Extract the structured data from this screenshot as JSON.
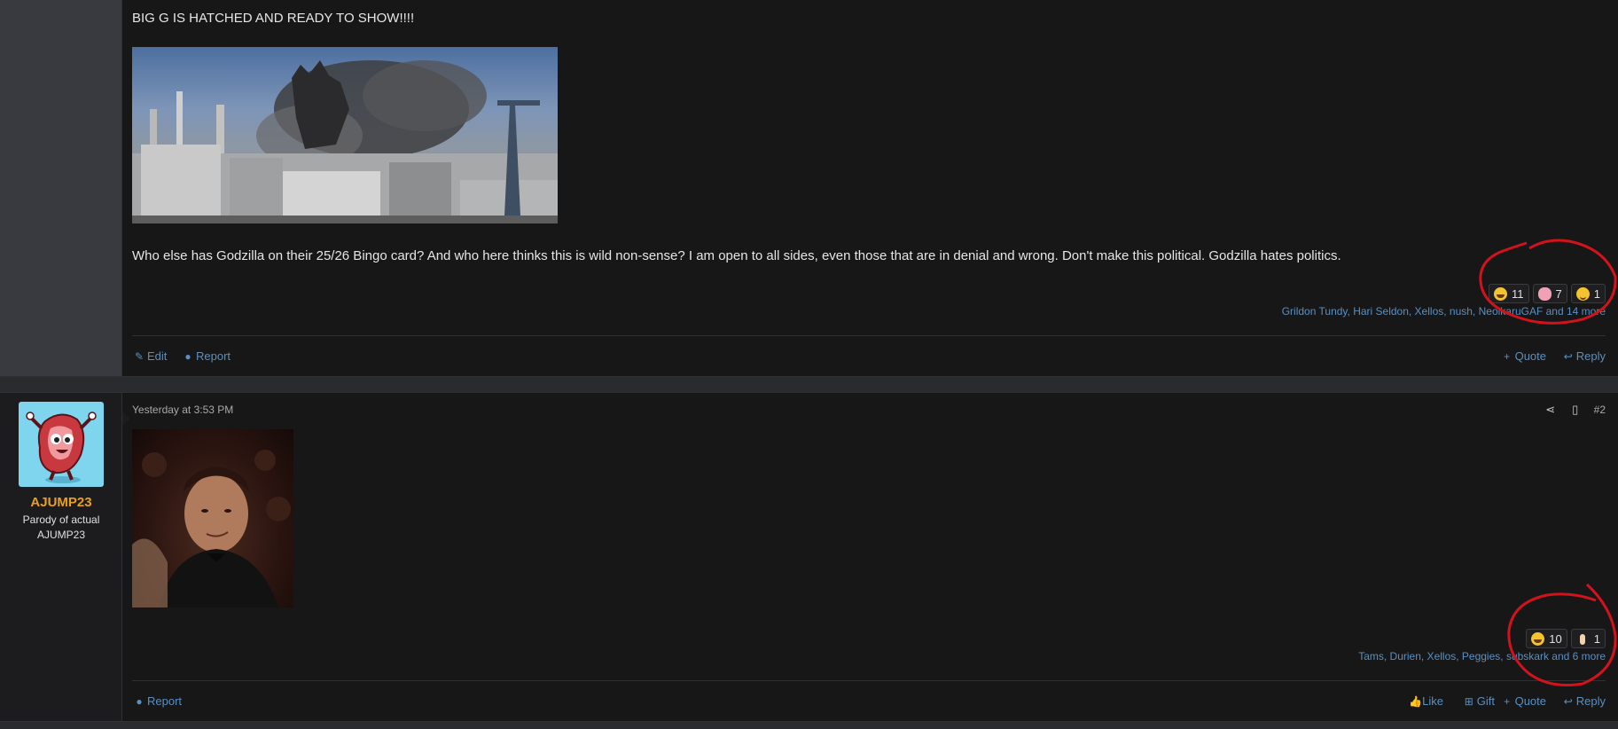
{
  "post1": {
    "heading": "BIG G IS HATCHED AND READY TO SHOW!!!!",
    "body": "Who else has Godzilla on their 25/26 Bingo card? And who here thinks this is wild non-sense? I am open to all sides, even those that are in denial and wrong. Don't make this political. Godzilla hates politics.",
    "reactions": [
      {
        "icon": "laughing-emoji-icon",
        "count": "11"
      },
      {
        "icon": "brain-emoji-icon",
        "count": "7"
      },
      {
        "icon": "smile-emoji-icon",
        "count": "1"
      }
    ],
    "likers": "Grildon Tundy, Hari Seldon, Xellos, nush, NeolkaruGAF and 14 more",
    "actions_left": {
      "edit": "Edit",
      "report": "Report"
    },
    "actions_right": {
      "quote": "Quote",
      "reply": "Reply"
    }
  },
  "post2": {
    "date": "Yesterday at 3:53 PM",
    "post_number": "#2",
    "user": {
      "name": "AJUMP23",
      "title": "Parody of actual AJUMP23"
    },
    "reactions": [
      {
        "icon": "laughing-emoji-icon",
        "count": "10"
      },
      {
        "icon": "thumbs-up-icon",
        "count": "1"
      }
    ],
    "likers": "Tams, Durien, Xellos, Peggies, subskark and 6 more",
    "actions_left": {
      "report": "Report"
    },
    "actions_right": {
      "like": "Like",
      "gift": "Gift",
      "quote": "Quote",
      "reply": "Reply"
    }
  },
  "colors": {
    "background": "#171718",
    "link": "#5a8fc0",
    "username": "#e8a01c",
    "annotation": "#d3121c"
  }
}
